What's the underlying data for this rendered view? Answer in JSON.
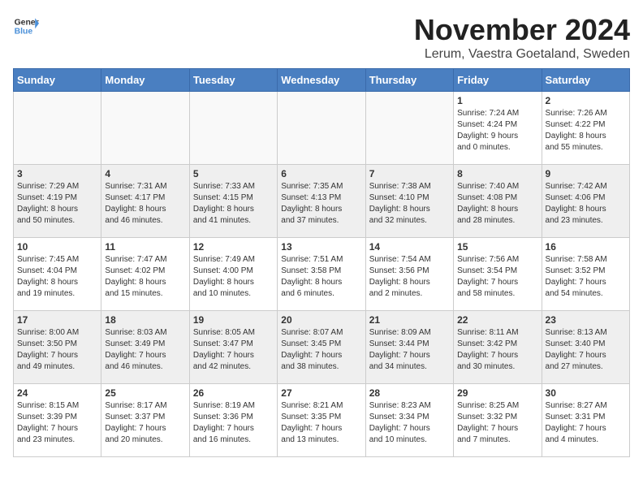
{
  "logo": {
    "text_general": "General",
    "text_blue": "Blue"
  },
  "title": "November 2024",
  "subtitle": "Lerum, Vaestra Goetaland, Sweden",
  "weekdays": [
    "Sunday",
    "Monday",
    "Tuesday",
    "Wednesday",
    "Thursday",
    "Friday",
    "Saturday"
  ],
  "weeks": [
    [
      {
        "day": "",
        "info": ""
      },
      {
        "day": "",
        "info": ""
      },
      {
        "day": "",
        "info": ""
      },
      {
        "day": "",
        "info": ""
      },
      {
        "day": "",
        "info": ""
      },
      {
        "day": "1",
        "info": "Sunrise: 7:24 AM\nSunset: 4:24 PM\nDaylight: 9 hours\nand 0 minutes."
      },
      {
        "day": "2",
        "info": "Sunrise: 7:26 AM\nSunset: 4:22 PM\nDaylight: 8 hours\nand 55 minutes."
      }
    ],
    [
      {
        "day": "3",
        "info": "Sunrise: 7:29 AM\nSunset: 4:19 PM\nDaylight: 8 hours\nand 50 minutes."
      },
      {
        "day": "4",
        "info": "Sunrise: 7:31 AM\nSunset: 4:17 PM\nDaylight: 8 hours\nand 46 minutes."
      },
      {
        "day": "5",
        "info": "Sunrise: 7:33 AM\nSunset: 4:15 PM\nDaylight: 8 hours\nand 41 minutes."
      },
      {
        "day": "6",
        "info": "Sunrise: 7:35 AM\nSunset: 4:13 PM\nDaylight: 8 hours\nand 37 minutes."
      },
      {
        "day": "7",
        "info": "Sunrise: 7:38 AM\nSunset: 4:10 PM\nDaylight: 8 hours\nand 32 minutes."
      },
      {
        "day": "8",
        "info": "Sunrise: 7:40 AM\nSunset: 4:08 PM\nDaylight: 8 hours\nand 28 minutes."
      },
      {
        "day": "9",
        "info": "Sunrise: 7:42 AM\nSunset: 4:06 PM\nDaylight: 8 hours\nand 23 minutes."
      }
    ],
    [
      {
        "day": "10",
        "info": "Sunrise: 7:45 AM\nSunset: 4:04 PM\nDaylight: 8 hours\nand 19 minutes."
      },
      {
        "day": "11",
        "info": "Sunrise: 7:47 AM\nSunset: 4:02 PM\nDaylight: 8 hours\nand 15 minutes."
      },
      {
        "day": "12",
        "info": "Sunrise: 7:49 AM\nSunset: 4:00 PM\nDaylight: 8 hours\nand 10 minutes."
      },
      {
        "day": "13",
        "info": "Sunrise: 7:51 AM\nSunset: 3:58 PM\nDaylight: 8 hours\nand 6 minutes."
      },
      {
        "day": "14",
        "info": "Sunrise: 7:54 AM\nSunset: 3:56 PM\nDaylight: 8 hours\nand 2 minutes."
      },
      {
        "day": "15",
        "info": "Sunrise: 7:56 AM\nSunset: 3:54 PM\nDaylight: 7 hours\nand 58 minutes."
      },
      {
        "day": "16",
        "info": "Sunrise: 7:58 AM\nSunset: 3:52 PM\nDaylight: 7 hours\nand 54 minutes."
      }
    ],
    [
      {
        "day": "17",
        "info": "Sunrise: 8:00 AM\nSunset: 3:50 PM\nDaylight: 7 hours\nand 49 minutes."
      },
      {
        "day": "18",
        "info": "Sunrise: 8:03 AM\nSunset: 3:49 PM\nDaylight: 7 hours\nand 46 minutes."
      },
      {
        "day": "19",
        "info": "Sunrise: 8:05 AM\nSunset: 3:47 PM\nDaylight: 7 hours\nand 42 minutes."
      },
      {
        "day": "20",
        "info": "Sunrise: 8:07 AM\nSunset: 3:45 PM\nDaylight: 7 hours\nand 38 minutes."
      },
      {
        "day": "21",
        "info": "Sunrise: 8:09 AM\nSunset: 3:44 PM\nDaylight: 7 hours\nand 34 minutes."
      },
      {
        "day": "22",
        "info": "Sunrise: 8:11 AM\nSunset: 3:42 PM\nDaylight: 7 hours\nand 30 minutes."
      },
      {
        "day": "23",
        "info": "Sunrise: 8:13 AM\nSunset: 3:40 PM\nDaylight: 7 hours\nand 27 minutes."
      }
    ],
    [
      {
        "day": "24",
        "info": "Sunrise: 8:15 AM\nSunset: 3:39 PM\nDaylight: 7 hours\nand 23 minutes."
      },
      {
        "day": "25",
        "info": "Sunrise: 8:17 AM\nSunset: 3:37 PM\nDaylight: 7 hours\nand 20 minutes."
      },
      {
        "day": "26",
        "info": "Sunrise: 8:19 AM\nSunset: 3:36 PM\nDaylight: 7 hours\nand 16 minutes."
      },
      {
        "day": "27",
        "info": "Sunrise: 8:21 AM\nSunset: 3:35 PM\nDaylight: 7 hours\nand 13 minutes."
      },
      {
        "day": "28",
        "info": "Sunrise: 8:23 AM\nSunset: 3:34 PM\nDaylight: 7 hours\nand 10 minutes."
      },
      {
        "day": "29",
        "info": "Sunrise: 8:25 AM\nSunset: 3:32 PM\nDaylight: 7 hours\nand 7 minutes."
      },
      {
        "day": "30",
        "info": "Sunrise: 8:27 AM\nSunset: 3:31 PM\nDaylight: 7 hours\nand 4 minutes."
      }
    ]
  ]
}
